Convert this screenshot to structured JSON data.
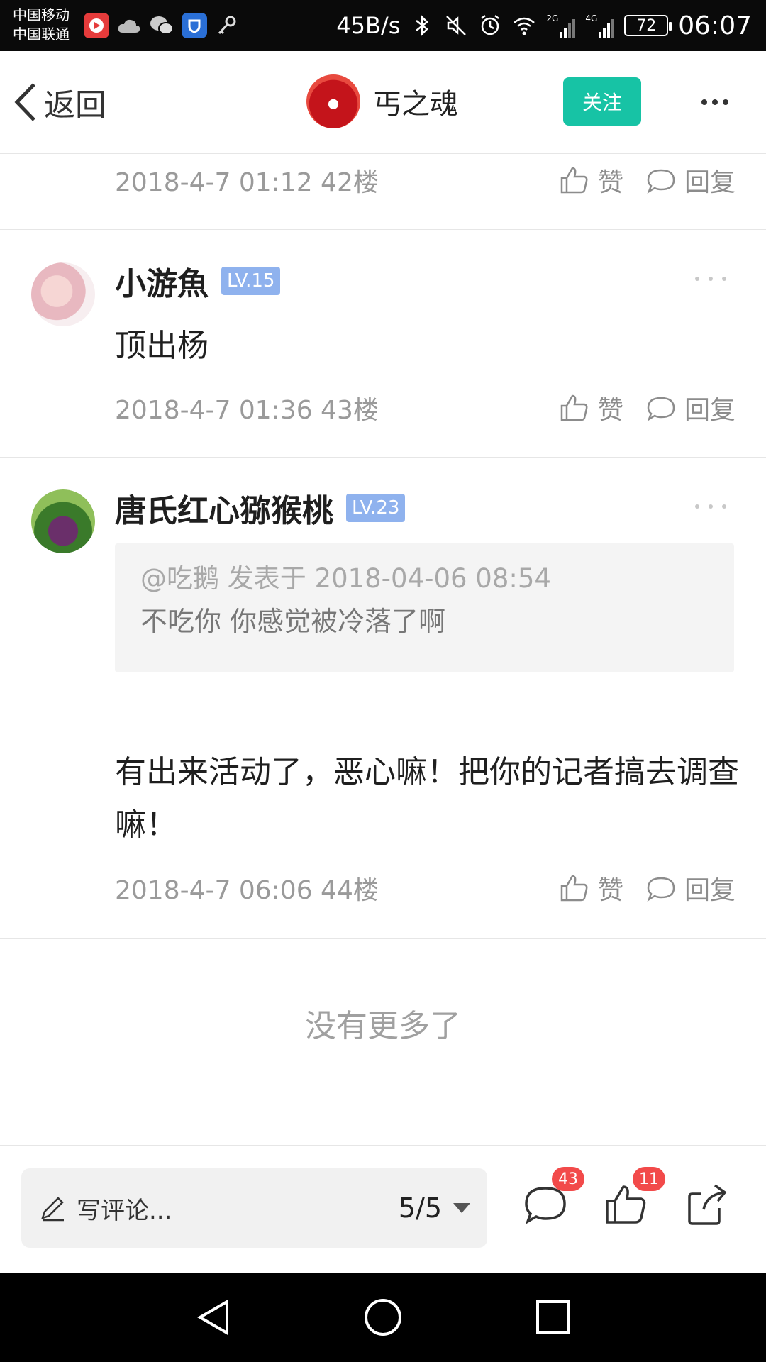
{
  "status_bar": {
    "carrier_1": "中国移动",
    "carrier_2": "中国联通",
    "speed": "45B/s",
    "battery": "72",
    "time": "06:07",
    "net_a": "2G",
    "net_b": "4G"
  },
  "header": {
    "back_label": "返回",
    "author_name": "丐之魂",
    "follow_label": "关注"
  },
  "comments": [
    {
      "meta": "2018-4-7 01:12  42楼",
      "like_label": "赞",
      "reply_label": "回复"
    },
    {
      "name": "小游魚",
      "level": "LV.15",
      "body": "顶出杨",
      "meta": "2018-4-7 01:36  43楼",
      "like_label": "赞",
      "reply_label": "回复"
    },
    {
      "name": "唐氏红心猕猴桃",
      "level": "LV.23",
      "quote_meta": "@吃鹅 发表于 2018-04-06 08:54",
      "quote_text": "不吃你   你感觉被冷落了啊",
      "body": "有出来活动了，恶心嘛！把你的记者搞去调查嘛！",
      "meta": "2018-4-7 06:06  44楼",
      "like_label": "赞",
      "reply_label": "回复"
    }
  ],
  "no_more": "没有更多了",
  "bottom_bar": {
    "comment_placeholder": "写评论...",
    "page_indicator": "5/5",
    "comment_count": "43",
    "like_count": "11"
  },
  "colors": {
    "accent": "#17c3a5",
    "level_badge": "#8fb2ee",
    "count_badge": "#f24a4a"
  }
}
